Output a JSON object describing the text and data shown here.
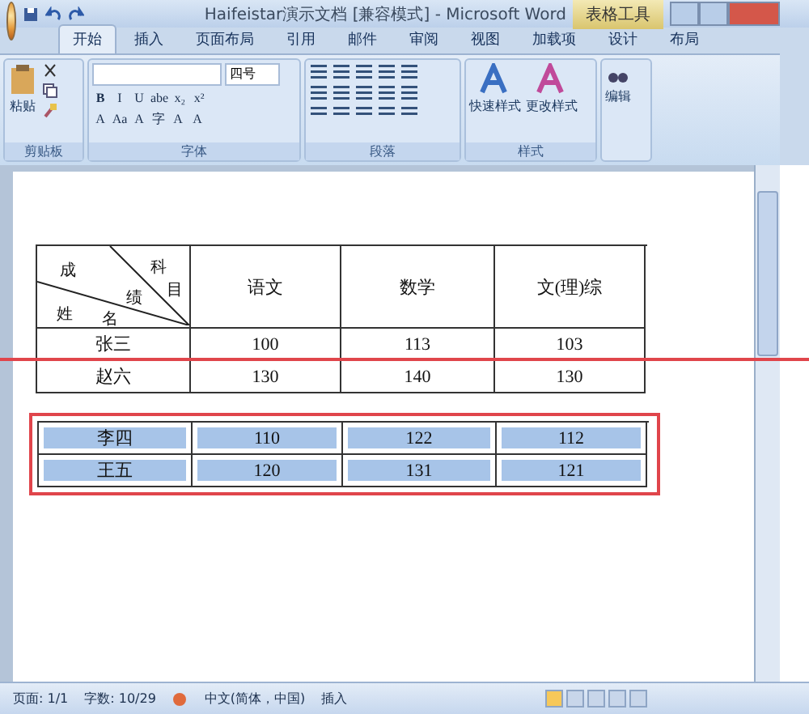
{
  "window": {
    "title": "Haifeistar演示文档 [兼容模式] - Microsoft Word",
    "context_tab": "表格工具"
  },
  "tabs": [
    {
      "label": "开始",
      "selected": true
    },
    {
      "label": "插入",
      "selected": false
    },
    {
      "label": "页面布局",
      "selected": false
    },
    {
      "label": "引用",
      "selected": false
    },
    {
      "label": "邮件",
      "selected": false
    },
    {
      "label": "审阅",
      "selected": false
    },
    {
      "label": "视图",
      "selected": false
    },
    {
      "label": "加载项",
      "selected": false
    },
    {
      "label": "设计",
      "selected": false
    },
    {
      "label": "布局",
      "selected": false
    }
  ],
  "ribbon": {
    "clipboard": {
      "paste": "粘贴",
      "label": "剪贴板"
    },
    "font": {
      "size": "四号",
      "row1": [
        "B",
        "I",
        "U",
        "abe",
        "x₂",
        "x²"
      ],
      "row2": [
        "A",
        "Aa",
        "A",
        "字",
        "A",
        "A"
      ],
      "label": "字体"
    },
    "paragraph": {
      "label": "段落"
    },
    "styles": {
      "buttons": [
        "快速样式",
        "更改样式"
      ],
      "label": "样式"
    },
    "editing": {
      "button": "编辑"
    }
  },
  "table": {
    "header": {
      "corner": [
        "成",
        "科",
        "目",
        "绩",
        "姓",
        "名"
      ],
      "columns": [
        "语文",
        "数学",
        "文(理)综"
      ]
    },
    "rows": [
      {
        "cells": [
          "张三",
          "100",
          "113",
          "103"
        ],
        "selected": false
      },
      {
        "cells": [
          "赵六",
          "130",
          "140",
          "130"
        ],
        "selected": false
      }
    ]
  },
  "red_line": true,
  "split_table": {
    "rows": [
      {
        "cells": [
          "李四",
          "110",
          "122",
          "112"
        ],
        "selected": true
      },
      {
        "cells": [
          "王五",
          "120",
          "131",
          "121"
        ],
        "selected": true
      }
    ]
  },
  "status_bar": {
    "items": [
      "页面: 1/1",
      "字数: 10/29"
    ],
    "language": "中文(简体，中国)",
    "mode": "插入"
  }
}
